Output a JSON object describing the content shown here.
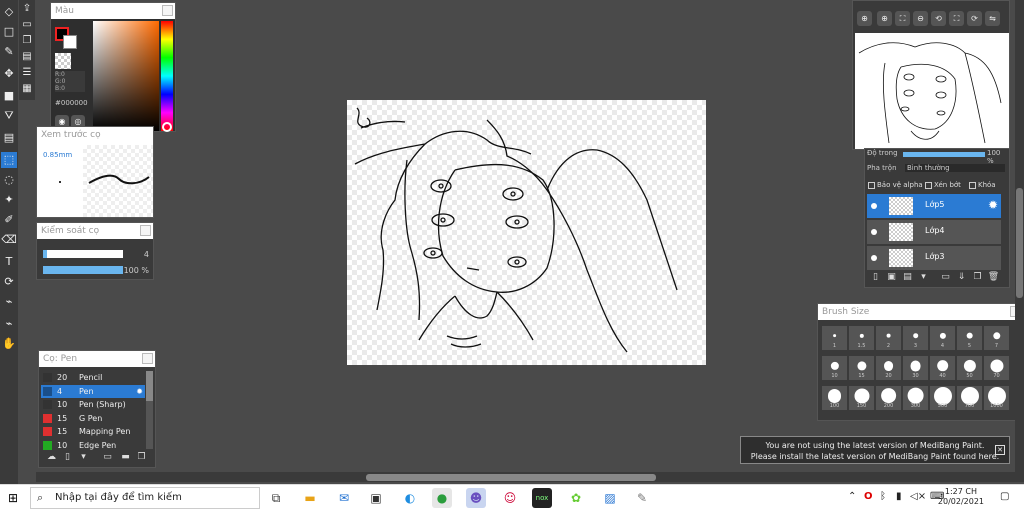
{
  "color_panel": {
    "title": "Màu",
    "r": "R:0",
    "g": "G:0",
    "b": "B:0",
    "hex": "#000000"
  },
  "preview_panel": {
    "title": "Xem trước cọ",
    "size": "0.85mm"
  },
  "control_panel": {
    "title": "Kiểm soát cọ",
    "size_value": "4",
    "size_fraction": 0.05,
    "opacity_value": "100 %",
    "opacity_fraction": 1.0
  },
  "brush_panel": {
    "title": "Cọ: Pen",
    "brushes": [
      {
        "size": "20",
        "name": "Pencil",
        "color": "#333333"
      },
      {
        "size": "4",
        "name": "Pen",
        "color": "#1a4f8a",
        "active": true
      },
      {
        "size": "10",
        "name": "Pen (Sharp)",
        "color": "#333333"
      },
      {
        "size": "15",
        "name": "G Pen",
        "color": "#e03030"
      },
      {
        "size": "15",
        "name": "Mapping Pen",
        "color": "#e03030"
      },
      {
        "size": "10",
        "name": "Edge Pen",
        "color": "#22aa22"
      }
    ]
  },
  "layer_panel": {
    "opacity_label": "Độ trong",
    "opacity_value": "100 %",
    "blend_label": "Pha trộn",
    "blend_value": "Bình thường",
    "protect_alpha": "Bảo vệ alpha",
    "clip": "Xén bớt",
    "lock": "Khóa",
    "layers": [
      {
        "name": "Lớp5",
        "active": true
      },
      {
        "name": "Lớp4",
        "active": false
      },
      {
        "name": "Lớp3",
        "active": false
      }
    ]
  },
  "size_panel": {
    "title": "Brush Size",
    "row1": [
      "1",
      "1.5",
      "2",
      "3",
      "4",
      "5",
      "7"
    ],
    "row2": [
      "10",
      "15",
      "20",
      "30",
      "40",
      "50",
      "70"
    ],
    "row3": [
      "100",
      "150",
      "200",
      "300",
      "500",
      "700",
      "1000"
    ]
  },
  "notice": {
    "line1": "You are not using the latest version of MediBang Paint.",
    "line2": "Please install the latest version of MediBang Paint found here."
  },
  "taskbar": {
    "search_placeholder": "Nhập tại đây để tìm kiếm",
    "time": "1:27 CH",
    "date": "20/02/2021"
  }
}
